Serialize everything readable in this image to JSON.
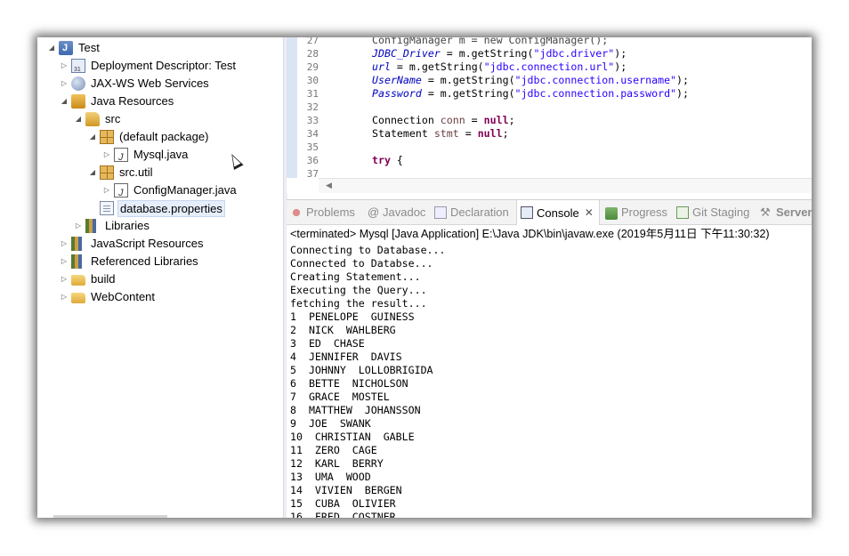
{
  "tree": {
    "items": [
      {
        "label": "Test",
        "icon": "java-project-icon"
      },
      {
        "label": "Deployment Descriptor: Test",
        "icon": "deployment-descriptor-icon"
      },
      {
        "label": "JAX-WS Web Services",
        "icon": "web-services-icon"
      },
      {
        "label": "Java Resources",
        "icon": "java-resources-icon"
      },
      {
        "label": "src",
        "icon": "source-folder-icon"
      },
      {
        "label": "(default package)",
        "icon": "package-icon"
      },
      {
        "label": "Mysql.java",
        "icon": "java-file-icon"
      },
      {
        "label": "src.util",
        "icon": "package-icon"
      },
      {
        "label": "ConfigManager.java",
        "icon": "java-file-icon"
      },
      {
        "label": "database.properties",
        "icon": "properties-file-icon"
      },
      {
        "label": "Libraries",
        "icon": "libraries-icon"
      },
      {
        "label": "JavaScript Resources",
        "icon": "javascript-resources-icon"
      },
      {
        "label": "Referenced Libraries",
        "icon": "referenced-libraries-icon"
      },
      {
        "label": "build",
        "icon": "folder-icon"
      },
      {
        "label": "WebContent",
        "icon": "folder-icon"
      }
    ]
  },
  "editor": {
    "lines": [
      {
        "no": "28",
        "field": "JDBC_Driver",
        "mid": " = m.getString(",
        "str": "\"jdbc.driver\"",
        "end": ");"
      },
      {
        "no": "29",
        "field": "url",
        "mid": " = m.getString(",
        "str": "\"jdbc.connection.url\"",
        "end": ");"
      },
      {
        "no": "30",
        "field": "UserName",
        "mid": " = m.getString(",
        "str": "\"jdbc.connection.username\"",
        "end": ");"
      },
      {
        "no": "31",
        "field": "Password",
        "mid": " = m.getString(",
        "str": "\"jdbc.connection.password\"",
        "end": ");"
      },
      {
        "no": "32"
      },
      {
        "no": "33",
        "pre": "Connection ",
        "var": "conn",
        "mid": " = ",
        "kw": "null",
        "end": ";"
      },
      {
        "no": "34",
        "pre": "Statement ",
        "var": "stmt",
        "mid": " = ",
        "kw": "null",
        "end": ";"
      },
      {
        "no": "35"
      },
      {
        "no": "36",
        "kw": "try",
        "end": " {"
      },
      {
        "no": "37"
      }
    ]
  },
  "console": {
    "tabs": [
      {
        "label": "Problems",
        "icon": "problems-icon"
      },
      {
        "label": "Javadoc",
        "icon": "javadoc-icon"
      },
      {
        "label": "Declaration",
        "icon": "declaration-icon"
      },
      {
        "label": "Console",
        "icon": "console-icon",
        "close": "✕"
      },
      {
        "label": "Progress",
        "icon": "progress-icon"
      },
      {
        "label": "Git Staging",
        "icon": "git-staging-icon"
      },
      {
        "label": "Server",
        "icon": "servers-icon"
      }
    ],
    "terminated": "<terminated> Mysql [Java Application] E:\\Java JDK\\bin\\javaw.exe (2019年5月11日 下午11:30:32)",
    "output": [
      "Connecting to Database...",
      "Connected to Databse...",
      "Creating Statement...",
      "Executing the Query...",
      "fetching the result...",
      "1  PENELOPE  GUINESS",
      "2  NICK  WAHLBERG",
      "3  ED  CHASE",
      "4  JENNIFER  DAVIS",
      "5  JOHNNY  LOLLOBRIGIDA",
      "6  BETTE  NICHOLSON",
      "7  GRACE  MOSTEL",
      "8  MATTHEW  JOHANSSON",
      "9  JOE  SWANK",
      "10  CHRISTIAN  GABLE",
      "11  ZERO  CAGE",
      "12  KARL  BERRY",
      "13  UMA  WOOD",
      "14  VIVIEN  BERGEN",
      "15  CUBA  OLIVIER",
      "16  FRED  COSTNER"
    ]
  }
}
